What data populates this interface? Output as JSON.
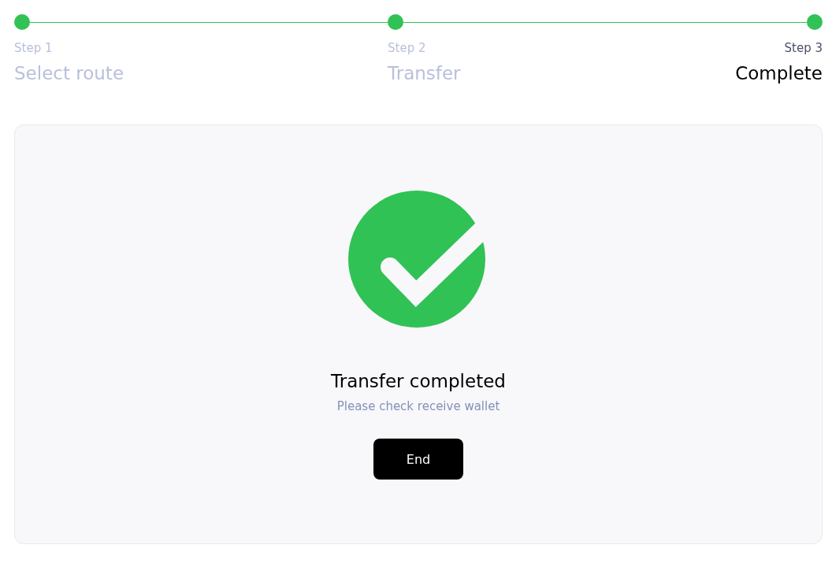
{
  "steps": [
    {
      "label": "Step 1",
      "title": "Select route",
      "done": true,
      "selected": false
    },
    {
      "label": "Step 2",
      "title": "Transfer",
      "done": true,
      "selected": false
    },
    {
      "label": "Step 3",
      "title": "Complete",
      "done": true,
      "selected": true
    }
  ],
  "result": {
    "title": "Transfer completed",
    "message": "Please check receive wallet",
    "button": "End"
  }
}
